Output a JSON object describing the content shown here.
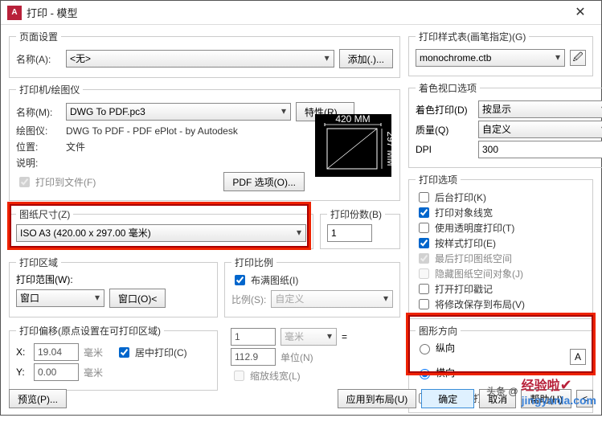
{
  "window": {
    "title": "打印 - 模型",
    "close": "✕"
  },
  "pageSetup": {
    "legend": "页面设置",
    "nameLabel": "名称(A):",
    "nameValue": "<无>",
    "addBtn": "添加(.)..."
  },
  "printer": {
    "legend": "打印机/绘图仪",
    "nameLabel": "名称(M):",
    "nameValue": "DWG To PDF.pc3",
    "propBtn": "特性(R)...",
    "plotterLabel": "绘图仪:",
    "plotterValue": "DWG To PDF - PDF ePlot - by Autodesk",
    "locLabel": "位置:",
    "locValue": "文件",
    "descLabel": "说明:",
    "descValue": "",
    "toFile": "打印到文件(F)",
    "pdfBtn": "PDF 选项(O)...",
    "previewW": "420 MM",
    "previewH": "297 MM"
  },
  "paper": {
    "legend": "图纸尺寸(Z)",
    "value": "ISO A3 (420.00 x 297.00 毫米)"
  },
  "copies": {
    "legend": "打印份数(B)",
    "value": "1"
  },
  "area": {
    "legend": "打印区域",
    "rangeLabel": "打印范围(W):",
    "rangeValue": "窗口",
    "windowBtn": "窗口(O)<"
  },
  "scale": {
    "legend": "打印比例",
    "fit": "布满图纸(I)",
    "ratioLabel": "比例(S):",
    "ratioValue": "自定义",
    "topVal": "1",
    "topUnit": "毫米",
    "eq": "=",
    "botVal": "112.9",
    "botUnit": "单位(N)",
    "scaleLW": "缩放线宽(L)"
  },
  "offset": {
    "legend": "打印偏移(原点设置在可打印区域)",
    "x": "X:",
    "xVal": "19.04",
    "xUnit": "毫米",
    "y": "Y:",
    "yVal": "0.00",
    "yUnit": "毫米",
    "center": "居中打印(C)"
  },
  "styleTable": {
    "legend": "打印样式表(画笔指定)(G)",
    "value": "monochrome.ctb"
  },
  "viewport": {
    "legend": "着色视口选项",
    "shadeLabel": "着色打印(D)",
    "shadeValue": "按显示",
    "qLabel": "质量(Q)",
    "qValue": "自定义",
    "dpiLabel": "DPI",
    "dpiValue": "300"
  },
  "options": {
    "legend": "打印选项",
    "bg": "后台打印(K)",
    "lw": "打印对象线宽",
    "trans": "使用透明度打印(T)",
    "byStyle": "按样式打印(E)",
    "lastPS": "最后打印图纸空间",
    "hidePS": "隐藏图纸空间对象(J)",
    "stamp": "打开打印戳记",
    "saveLayout": "将修改保存到布局(V)"
  },
  "orient": {
    "legend": "图形方向",
    "portrait": "纵向",
    "landscape": "横向",
    "upside": "上下颠倒打印(-)"
  },
  "footer": {
    "preview": "预览(P)...",
    "apply": "应用到布局(U)",
    "ok": "确定",
    "cancel": "取消",
    "help": "帮助(H)",
    "more": "<"
  },
  "wm": {
    "t1": "头条 @",
    "t2": "经验啦",
    "t3": "jingyanla.com",
    "check": "✔"
  }
}
